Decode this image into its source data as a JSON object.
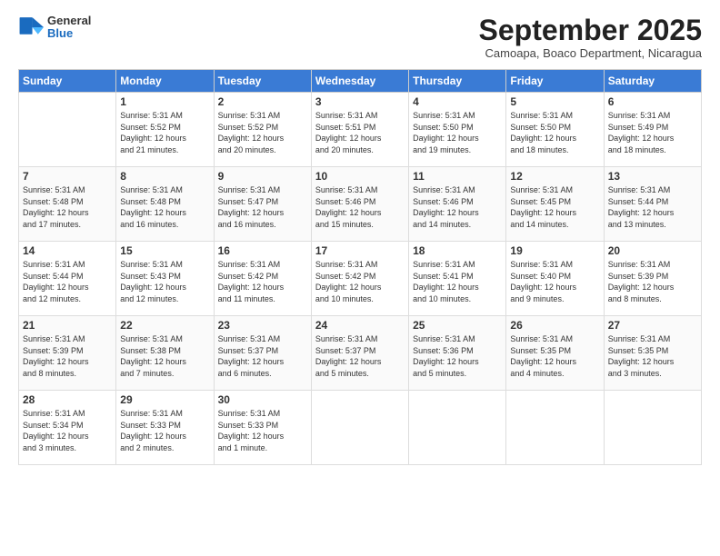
{
  "logo": {
    "general": "General",
    "blue": "Blue"
  },
  "header": {
    "month": "September 2025",
    "location": "Camoapa, Boaco Department, Nicaragua"
  },
  "days": [
    "Sunday",
    "Monday",
    "Tuesday",
    "Wednesday",
    "Thursday",
    "Friday",
    "Saturday"
  ],
  "weeks": [
    [
      {
        "day": "",
        "info": ""
      },
      {
        "day": "1",
        "info": "Sunrise: 5:31 AM\nSunset: 5:52 PM\nDaylight: 12 hours\nand 21 minutes."
      },
      {
        "day": "2",
        "info": "Sunrise: 5:31 AM\nSunset: 5:52 PM\nDaylight: 12 hours\nand 20 minutes."
      },
      {
        "day": "3",
        "info": "Sunrise: 5:31 AM\nSunset: 5:51 PM\nDaylight: 12 hours\nand 20 minutes."
      },
      {
        "day": "4",
        "info": "Sunrise: 5:31 AM\nSunset: 5:50 PM\nDaylight: 12 hours\nand 19 minutes."
      },
      {
        "day": "5",
        "info": "Sunrise: 5:31 AM\nSunset: 5:50 PM\nDaylight: 12 hours\nand 18 minutes."
      },
      {
        "day": "6",
        "info": "Sunrise: 5:31 AM\nSunset: 5:49 PM\nDaylight: 12 hours\nand 18 minutes."
      }
    ],
    [
      {
        "day": "7",
        "info": "Sunrise: 5:31 AM\nSunset: 5:48 PM\nDaylight: 12 hours\nand 17 minutes."
      },
      {
        "day": "8",
        "info": "Sunrise: 5:31 AM\nSunset: 5:48 PM\nDaylight: 12 hours\nand 16 minutes."
      },
      {
        "day": "9",
        "info": "Sunrise: 5:31 AM\nSunset: 5:47 PM\nDaylight: 12 hours\nand 16 minutes."
      },
      {
        "day": "10",
        "info": "Sunrise: 5:31 AM\nSunset: 5:46 PM\nDaylight: 12 hours\nand 15 minutes."
      },
      {
        "day": "11",
        "info": "Sunrise: 5:31 AM\nSunset: 5:46 PM\nDaylight: 12 hours\nand 14 minutes."
      },
      {
        "day": "12",
        "info": "Sunrise: 5:31 AM\nSunset: 5:45 PM\nDaylight: 12 hours\nand 14 minutes."
      },
      {
        "day": "13",
        "info": "Sunrise: 5:31 AM\nSunset: 5:44 PM\nDaylight: 12 hours\nand 13 minutes."
      }
    ],
    [
      {
        "day": "14",
        "info": "Sunrise: 5:31 AM\nSunset: 5:44 PM\nDaylight: 12 hours\nand 12 minutes."
      },
      {
        "day": "15",
        "info": "Sunrise: 5:31 AM\nSunset: 5:43 PM\nDaylight: 12 hours\nand 12 minutes."
      },
      {
        "day": "16",
        "info": "Sunrise: 5:31 AM\nSunset: 5:42 PM\nDaylight: 12 hours\nand 11 minutes."
      },
      {
        "day": "17",
        "info": "Sunrise: 5:31 AM\nSunset: 5:42 PM\nDaylight: 12 hours\nand 10 minutes."
      },
      {
        "day": "18",
        "info": "Sunrise: 5:31 AM\nSunset: 5:41 PM\nDaylight: 12 hours\nand 10 minutes."
      },
      {
        "day": "19",
        "info": "Sunrise: 5:31 AM\nSunset: 5:40 PM\nDaylight: 12 hours\nand 9 minutes."
      },
      {
        "day": "20",
        "info": "Sunrise: 5:31 AM\nSunset: 5:39 PM\nDaylight: 12 hours\nand 8 minutes."
      }
    ],
    [
      {
        "day": "21",
        "info": "Sunrise: 5:31 AM\nSunset: 5:39 PM\nDaylight: 12 hours\nand 8 minutes."
      },
      {
        "day": "22",
        "info": "Sunrise: 5:31 AM\nSunset: 5:38 PM\nDaylight: 12 hours\nand 7 minutes."
      },
      {
        "day": "23",
        "info": "Sunrise: 5:31 AM\nSunset: 5:37 PM\nDaylight: 12 hours\nand 6 minutes."
      },
      {
        "day": "24",
        "info": "Sunrise: 5:31 AM\nSunset: 5:37 PM\nDaylight: 12 hours\nand 5 minutes."
      },
      {
        "day": "25",
        "info": "Sunrise: 5:31 AM\nSunset: 5:36 PM\nDaylight: 12 hours\nand 5 minutes."
      },
      {
        "day": "26",
        "info": "Sunrise: 5:31 AM\nSunset: 5:35 PM\nDaylight: 12 hours\nand 4 minutes."
      },
      {
        "day": "27",
        "info": "Sunrise: 5:31 AM\nSunset: 5:35 PM\nDaylight: 12 hours\nand 3 minutes."
      }
    ],
    [
      {
        "day": "28",
        "info": "Sunrise: 5:31 AM\nSunset: 5:34 PM\nDaylight: 12 hours\nand 3 minutes."
      },
      {
        "day": "29",
        "info": "Sunrise: 5:31 AM\nSunset: 5:33 PM\nDaylight: 12 hours\nand 2 minutes."
      },
      {
        "day": "30",
        "info": "Sunrise: 5:31 AM\nSunset: 5:33 PM\nDaylight: 12 hours\nand 1 minute."
      },
      {
        "day": "",
        "info": ""
      },
      {
        "day": "",
        "info": ""
      },
      {
        "day": "",
        "info": ""
      },
      {
        "day": "",
        "info": ""
      }
    ]
  ]
}
